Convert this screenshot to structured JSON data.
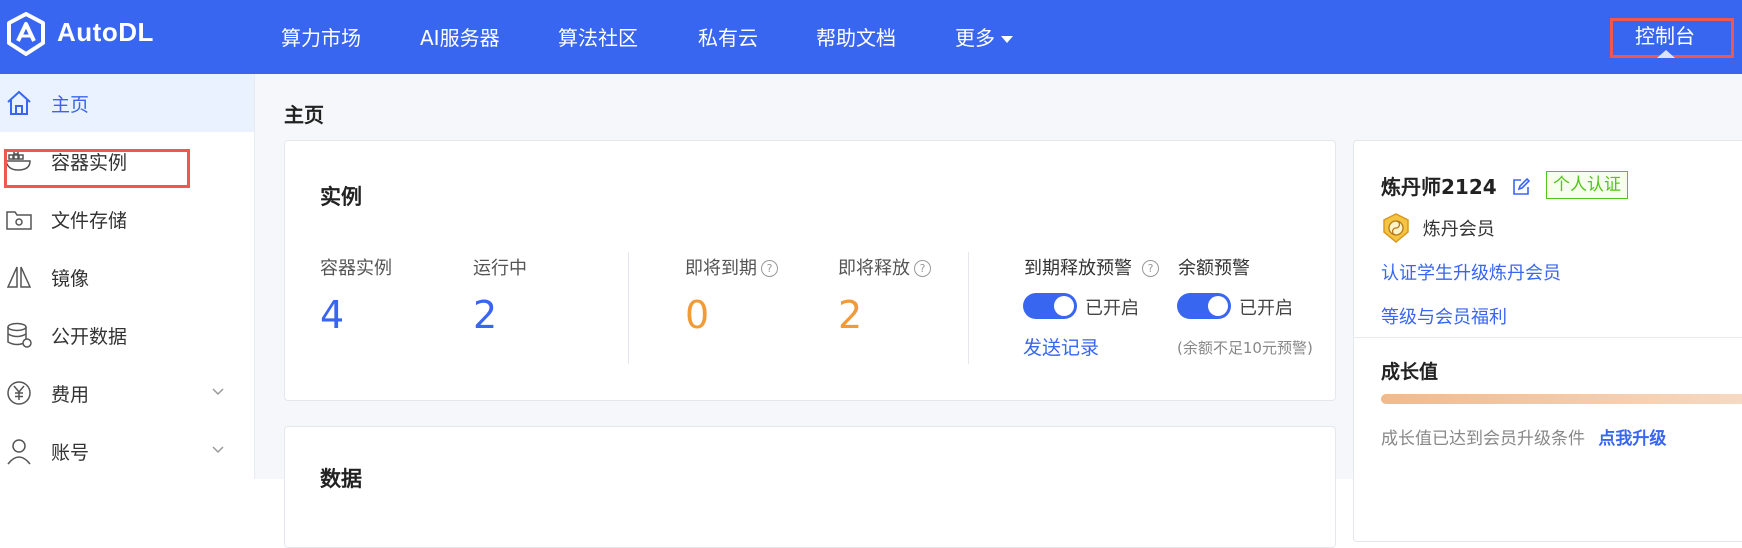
{
  "brand": {
    "name": "AutoDL"
  },
  "nav": {
    "items": [
      "算力市场",
      "AI服务器",
      "算法社区",
      "私有云",
      "帮助文档"
    ],
    "more_label": "更多",
    "console_label": "控制台"
  },
  "sidebar": {
    "items": [
      {
        "label": "主页",
        "icon": "home-icon",
        "active": true
      },
      {
        "label": "容器实例",
        "icon": "container-icon",
        "active": false,
        "highlighted": true
      },
      {
        "label": "文件存储",
        "icon": "folder-icon",
        "active": false
      },
      {
        "label": "镜像",
        "icon": "mirror-icon",
        "active": false
      },
      {
        "label": "公开数据",
        "icon": "database-icon",
        "active": false
      },
      {
        "label": "费用",
        "icon": "yen-icon",
        "active": false,
        "expandable": true
      },
      {
        "label": "账号",
        "icon": "user-icon",
        "active": false,
        "expandable": true
      }
    ]
  },
  "main": {
    "page_title": "主页",
    "instances_card": {
      "title": "实例",
      "stats": [
        {
          "label": "容器实例",
          "value": "4",
          "color": "#3866f0"
        },
        {
          "label": "运行中",
          "value": "2",
          "color": "#3866f0"
        },
        {
          "label": "即将到期",
          "value": "0",
          "color": "#f29a38",
          "help": true
        },
        {
          "label": "即将释放",
          "value": "2",
          "color": "#f29a38",
          "help": true
        }
      ],
      "expire_alert": {
        "label": "到期释放预警",
        "status": "已开启",
        "enabled": true,
        "link": "发送记录"
      },
      "balance_alert": {
        "label": "余额预警",
        "status": "已开启",
        "enabled": true,
        "note": "(余额不足10元预警)"
      }
    },
    "data_card": {
      "title": "数据"
    },
    "profile_card": {
      "username": "炼丹师2124",
      "cert_badge": "个人认证",
      "member_level": "炼丹会员",
      "links": [
        "认证学生升级炼丹会员",
        "等级与会员福利"
      ],
      "growth_title": "成长值",
      "growth_progress_percent": 100,
      "growth_text": "成长值已达到会员升级条件",
      "upgrade_link": "点我升级"
    }
  },
  "colors": {
    "primary": "#3866f0",
    "orange": "#f29a38",
    "highlight": "#f0574f",
    "green": "#52c41a"
  }
}
